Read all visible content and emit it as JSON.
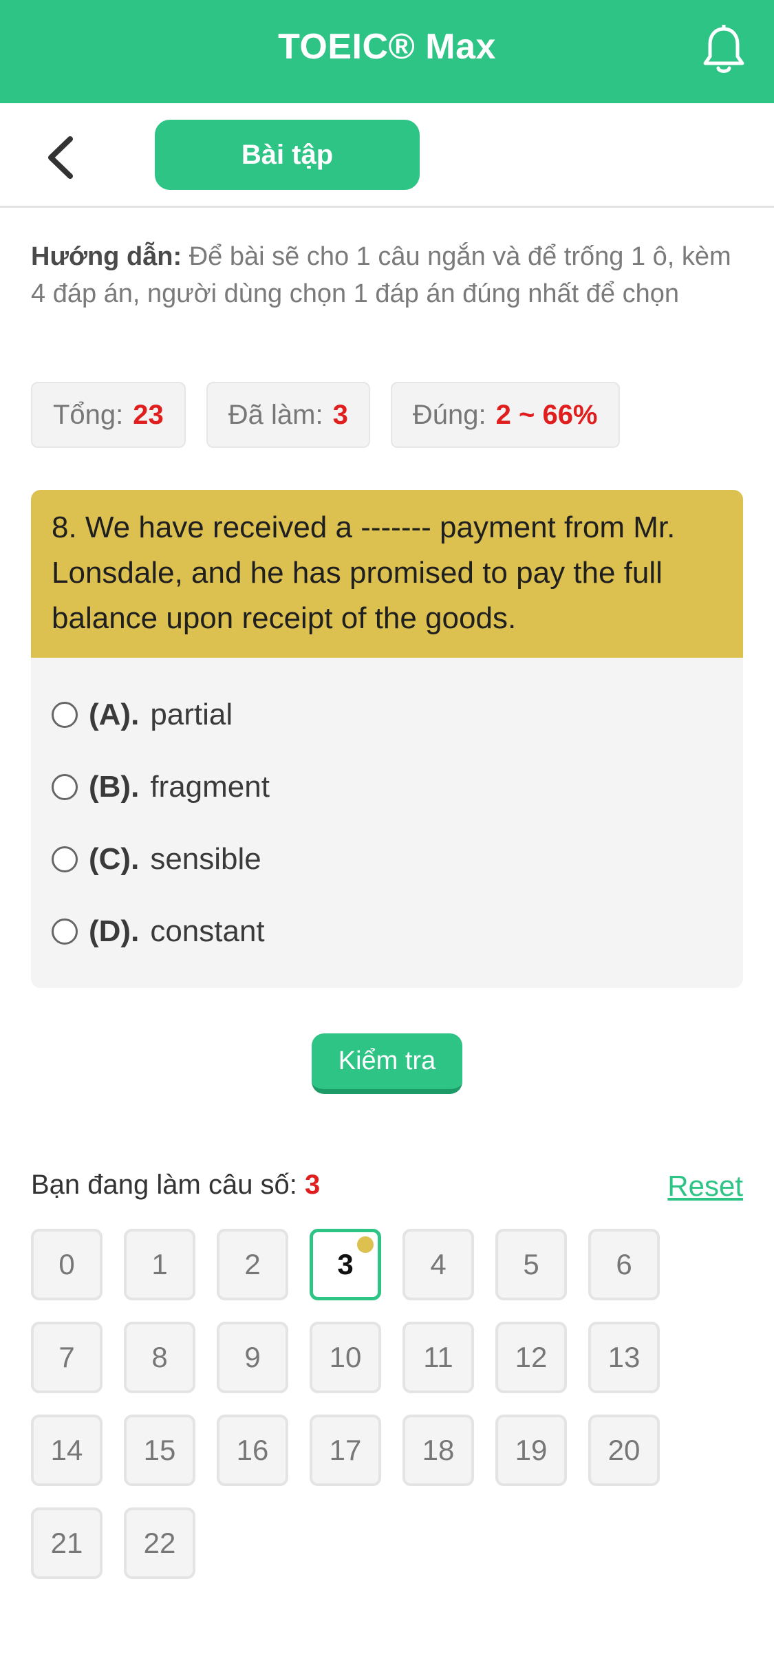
{
  "header": {
    "title": "TOEIC® Max",
    "icon": "bell-icon"
  },
  "subheader": {
    "back_icon": "chevron-left-icon",
    "tab_label": "Bài tập"
  },
  "guide": {
    "label": "Hướng dẫn:",
    "text": "Để bài sẽ cho 1 câu ngắn và để trống 1 ô, kèm 4 đáp án, người dùng chọn 1 đáp án đúng nhất để chọn"
  },
  "stats": {
    "total_label": "Tổng:",
    "total_value": "23",
    "done_label": "Đã làm:",
    "done_value": "3",
    "correct_label": "Đúng:",
    "correct_value": "2 ~ 66%"
  },
  "question": {
    "text": "8. We have received a ------- payment from Mr. Lonsdale, and he has promised to pay the full balance upon receipt of the goods.",
    "options": [
      {
        "label": "(A).",
        "text": "partial"
      },
      {
        "label": "(B).",
        "text": "fragment"
      },
      {
        "label": "(C).",
        "text": "sensible"
      },
      {
        "label": "(D).",
        "text": "constant"
      }
    ]
  },
  "check_button": "Kiểm tra",
  "progress": {
    "label": "Bạn đang làm câu số:",
    "current": "3",
    "reset_label": "Reset"
  },
  "grid": [
    "0",
    "1",
    "2",
    "3",
    "4",
    "5",
    "6",
    "7",
    "8",
    "9",
    "10",
    "11",
    "12",
    "13",
    "14",
    "15",
    "16",
    "17",
    "18",
    "19",
    "20",
    "21",
    "22"
  ],
  "colors": {
    "primary": "#2ec486",
    "question_bg": "#dcc050",
    "highlight": "#e01e1e"
  }
}
